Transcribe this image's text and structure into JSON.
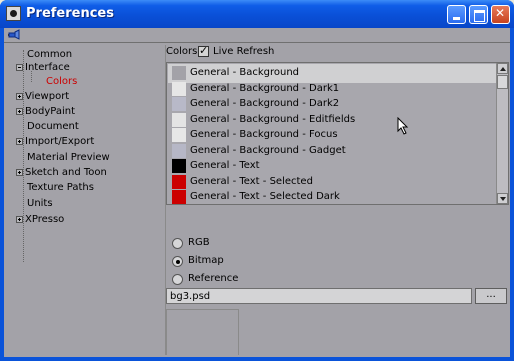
{
  "window": {
    "title": "Preferences"
  },
  "tree": {
    "items": [
      {
        "label": "Common",
        "expander": "none"
      },
      {
        "label": "Interface",
        "expander": "minus"
      },
      {
        "label": "Colors",
        "expander": "none",
        "selected": true
      },
      {
        "label": "Viewport",
        "expander": "plus"
      },
      {
        "label": "BodyPaint",
        "expander": "plus"
      },
      {
        "label": "Document",
        "expander": "none"
      },
      {
        "label": "Import/Export",
        "expander": "plus"
      },
      {
        "label": "Material Preview",
        "expander": "none"
      },
      {
        "label": "Sketch and Toon",
        "expander": "plus"
      },
      {
        "label": "Texture Paths",
        "expander": "none"
      },
      {
        "label": "Units",
        "expander": "none"
      },
      {
        "label": "XPresso",
        "expander": "plus"
      }
    ]
  },
  "colors_panel": {
    "label": "Colors",
    "live_refresh_label": "Live Refresh",
    "live_refresh_checked": true,
    "rows": [
      {
        "label": "General - Background",
        "swatch": "#a3a2a8"
      },
      {
        "label": "General - Background - Dark1",
        "swatch": "#e6e6e6"
      },
      {
        "label": "General - Background - Dark2",
        "swatch": "#b8b9c8"
      },
      {
        "label": "General - Background - Editfields",
        "swatch": "#e4e4e4"
      },
      {
        "label": "General - Background - Focus",
        "swatch": "#e7e7e7"
      },
      {
        "label": "General - Background - Gadget",
        "swatch": "#b6b7c6"
      },
      {
        "label": "General - Text",
        "swatch": "#000000"
      },
      {
        "label": "General - Text - Selected",
        "swatch": "#cc0000"
      },
      {
        "label": "General - Text - Selected Dark",
        "swatch": "#cc0000"
      }
    ]
  },
  "source": {
    "options": [
      "RGB",
      "Bitmap",
      "Reference"
    ],
    "selected": "Bitmap",
    "file_value": "bg3.psd",
    "browse_label": "..."
  }
}
